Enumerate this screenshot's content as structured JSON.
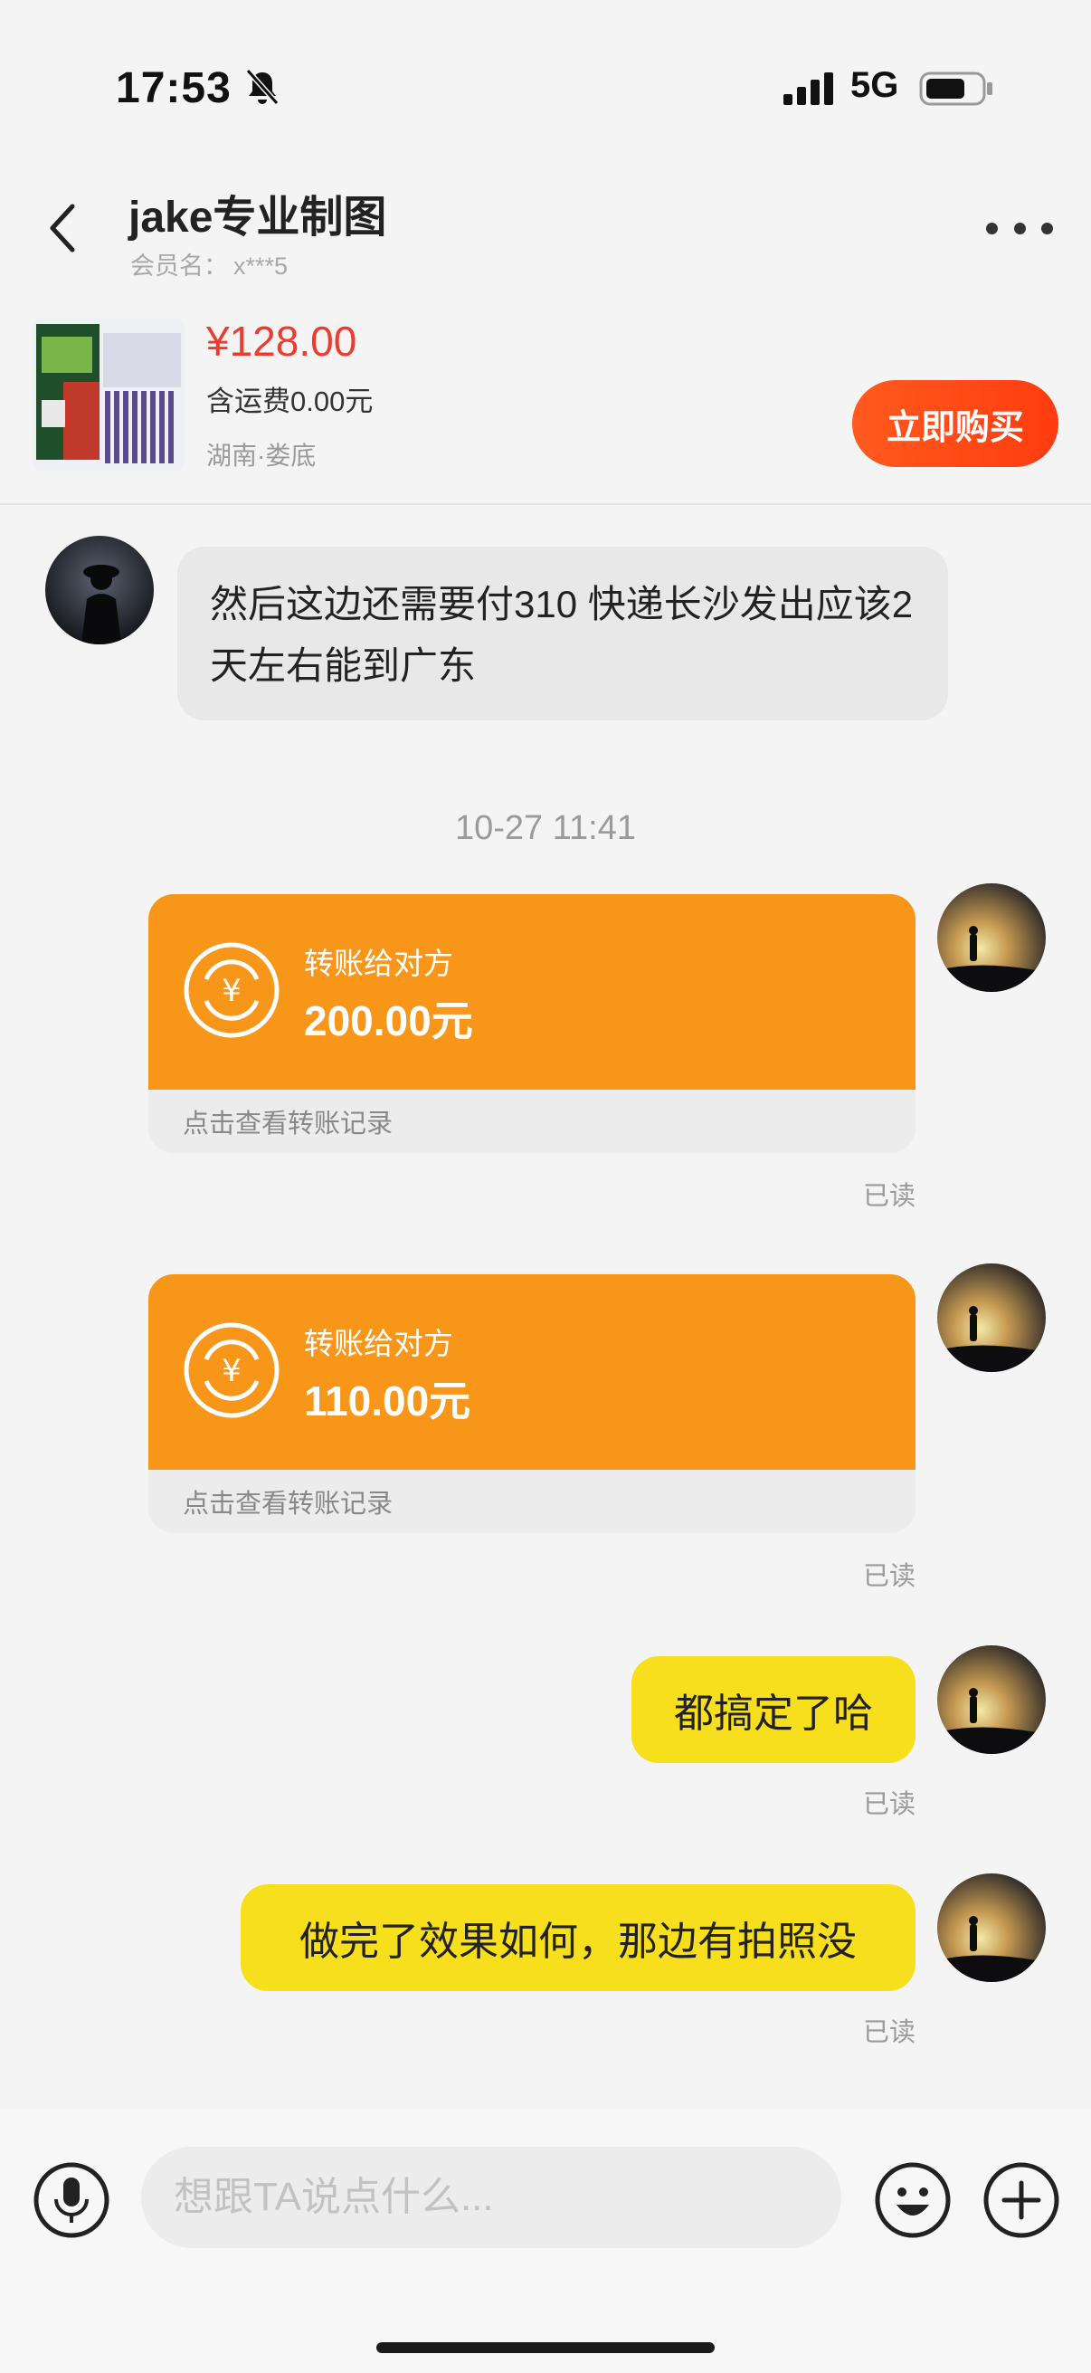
{
  "status_bar": {
    "time": "17:53",
    "network": "5G",
    "icons": [
      "bell-muted-icon",
      "signal-icon",
      "battery-icon"
    ]
  },
  "header": {
    "title": "jake专业制图",
    "member_label": "会员名：",
    "member_value": "x***5",
    "icons": [
      "back-chevron-icon",
      "more-dots-icon"
    ]
  },
  "product": {
    "price": "¥128.00",
    "shipping": "含运费0.00元",
    "location": "湖南·娄底",
    "buy_label": "立即购买"
  },
  "messages": {
    "incoming_text": "然后这边还需要付310 快递长沙发出应该2天左右能到广东",
    "timestamp": "10-27 11:41",
    "transfer_1": {
      "label": "转账给对方",
      "amount": "200.00元",
      "footer": "点击查看转账记录",
      "read": "已读"
    },
    "transfer_2": {
      "label": "转账给对方",
      "amount": "110.00元",
      "footer": "点击查看转账记录",
      "read": "已读"
    },
    "out_1": {
      "text": "都搞定了哈",
      "read": "已读"
    },
    "out_2": {
      "text": "做完了效果如何，那边有拍照没",
      "read": "已读"
    }
  },
  "input_bar": {
    "placeholder": "想跟TA说点什么...",
    "icons": [
      "microphone-icon",
      "emoji-icon",
      "plus-icon"
    ]
  },
  "colors": {
    "transfer_orange": "#f8961a",
    "outgoing_yellow": "#f7df1e",
    "price_red": "#ee3b2e",
    "buy_button": "#ff4a15"
  }
}
